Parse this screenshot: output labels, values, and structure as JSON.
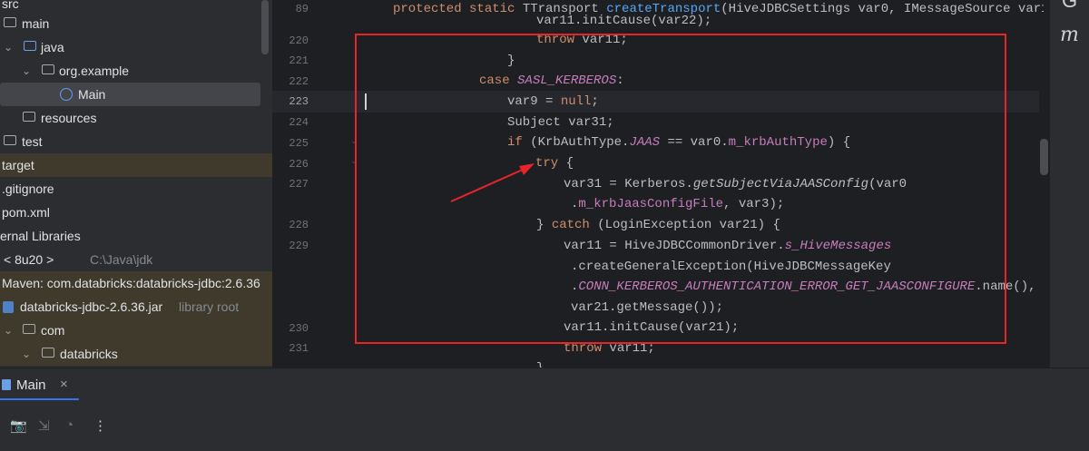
{
  "project_tree": {
    "items": [
      {
        "label": "src"
      },
      {
        "label": "main"
      },
      {
        "label": "java"
      },
      {
        "label": "org.example"
      },
      {
        "label": "Main"
      },
      {
        "label": "resources"
      },
      {
        "label": "test"
      },
      {
        "label": "target"
      },
      {
        "label": ".gitignore"
      },
      {
        "label": "pom.xml"
      },
      {
        "label": "ernal Libraries"
      },
      {
        "label": "< 8u20 >",
        "path": "C:\\Java\\jdk"
      },
      {
        "label": "Maven: com.databricks:databricks-jdbc:2.6.36"
      },
      {
        "label": "databricks-jdbc-2.6.36.jar",
        "suffix": "library root"
      },
      {
        "label": "com"
      },
      {
        "label": "databricks"
      }
    ]
  },
  "editor": {
    "line_numbers": [
      "89",
      "220",
      "221",
      "222",
      "223",
      "224",
      "225",
      "226",
      "227",
      "228",
      "229",
      "230",
      "231"
    ],
    "lines": {
      "l0_a": "protected static",
      "l0_b": " TTransport ",
      "l0_c": "createTransport",
      "l0_d": "(HiveJDBCSettings var0, IMessageSource var1,",
      "l1": "var11.initCause(var22);",
      "l2_kw": "throw",
      "l2_rest": " var11;",
      "l3": "}",
      "l4_kw": "case ",
      "l4_st": "SASL_KERBEROS",
      "l4_rest": ":",
      "l5_a": "var9 = ",
      "l5_kw": "null",
      "l5_b": ";",
      "l6": "Subject var31;",
      "l7_kw": "if",
      "l7_a": " (KrbAuthType.",
      "l7_st": "JAAS",
      "l7_b": " == var0.",
      "l7_fd": "m_krbAuthType",
      "l7_c": ") {",
      "l8_kw": "try",
      "l8_rest": " {",
      "l9_a": "var31 = Kerberos.",
      "l9_it": "getSubjectViaJAASConfig",
      "l9_b": "(var0",
      "l10_a": ".",
      "l10_fd": "m_krbJaasConfigFile",
      "l10_b": ", var3);",
      "l11_a": "} ",
      "l11_kw": "catch",
      "l11_b": " (LoginException var21) {",
      "l12_a": "var11 = HiveJDBCCommonDriver.",
      "l12_st": "s_HiveMessages",
      "l13": ".createGeneralException(HiveJDBCMessageKey",
      "l14_a": ".",
      "l14_st": "CONN_KERBEROS_AUTHENTICATION_ERROR_GET_JAASCONFIGURE",
      "l14_b": ".name(),",
      "l15": "var21.getMessage());",
      "l16": "var11.initCause(var21);",
      "l17_kw": "throw",
      "l17_rest": " var11;",
      "l18": "}"
    }
  },
  "right_toolbar": {
    "m_label": "m",
    "top_glyph": "G"
  },
  "run_panel": {
    "tab_label": "Main",
    "close": "×"
  },
  "bottom_tools": {
    "camera": "📷",
    "login": "⇲",
    "gauge": "◔",
    "more": "⋮"
  },
  "colors": {
    "annotation": "#e8242b",
    "keyword": "#cf8e6d",
    "method": "#56a8f5",
    "static_field": "#c77dbb"
  }
}
